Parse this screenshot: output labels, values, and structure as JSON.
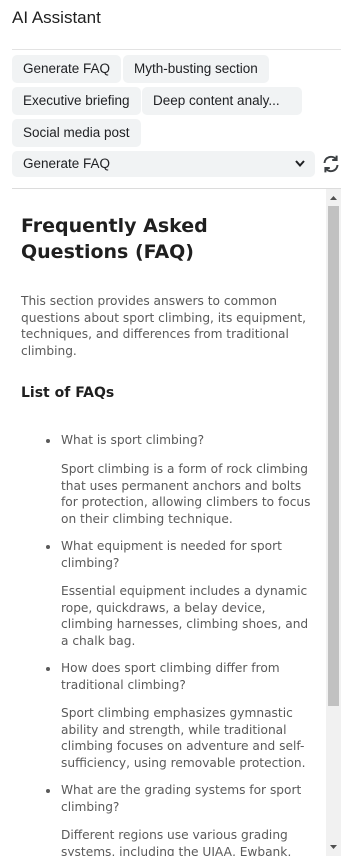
{
  "header": {
    "title": "AI Assistant"
  },
  "chips": [
    {
      "label": "Generate FAQ"
    },
    {
      "label": "Myth-busting section"
    },
    {
      "label": "Executive briefing"
    },
    {
      "label": "Deep content analysis"
    },
    {
      "label": "Social media post"
    }
  ],
  "select": {
    "value": "Generate FAQ",
    "icon": "chevron-down-icon"
  },
  "refresh": {
    "icon": "refresh-icon"
  },
  "doc": {
    "title": "Frequently Asked Questions (FAQ)",
    "intro": "This section provides answers to common questions about sport climbing, its equipment, techniques, and differences from traditional climbing.",
    "list_heading": "List of FAQs",
    "faqs": [
      {
        "q": "What is sport climbing?",
        "a": "Sport climbing is a form of rock climbing that uses permanent anchors and bolts for protection, allowing climbers to focus on their climbing technique."
      },
      {
        "q": "What equipment is needed for sport climbing?",
        "a": "Essential equipment includes a dynamic rope, quickdraws, a belay device, climbing harnesses, climbing shoes, and a chalk bag."
      },
      {
        "q": "How does sport climbing differ from traditional climbing?",
        "a": "Sport climbing emphasizes gymnastic ability and strength, while traditional climbing focuses on adventure and self-sufficiency, using removable protection."
      },
      {
        "q": "What are the grading systems for sport climbing?",
        "a": "Different regions use various grading systems, including the UIAA, Ewbank,"
      }
    ]
  },
  "colors": {
    "chip_bg": "#f1f3f4",
    "text": "#202124",
    "muted": "#5a5a5a",
    "scroll_thumb": "#c1c1c1"
  }
}
